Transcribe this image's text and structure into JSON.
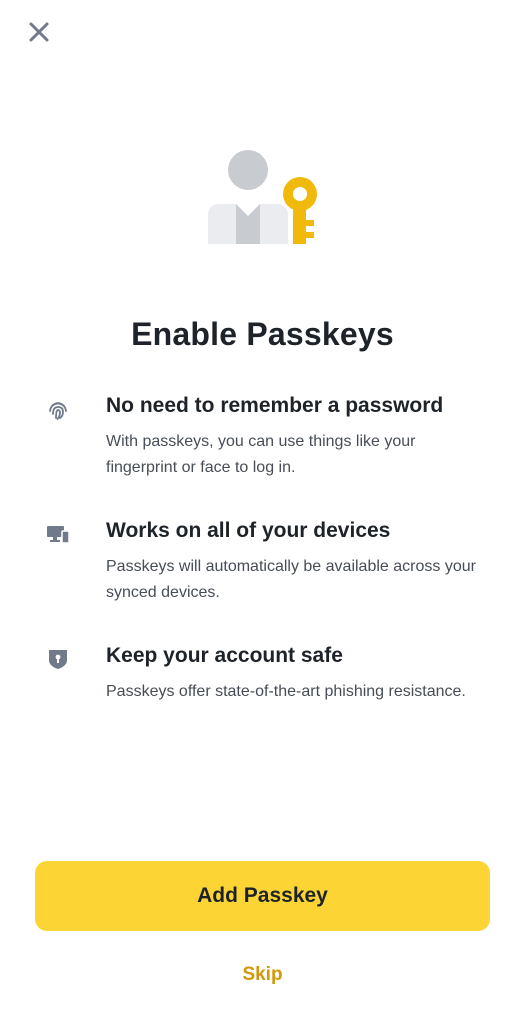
{
  "header": {
    "close_icon": "close-icon"
  },
  "hero": {
    "icon": "person-with-key-illustration",
    "colors": {
      "person": "#c8cbd0",
      "body": "#eaecef",
      "key": "#f0b90b"
    }
  },
  "title": "Enable Passkeys",
  "features": [
    {
      "icon": "fingerprint-icon",
      "heading": "No need to remember a password",
      "description": "With passkeys, you can use things like your fingerprint or face to log in."
    },
    {
      "icon": "devices-icon",
      "heading": "Works on all of your devices",
      "description": "Passkeys will automatically be available across your synced devices."
    },
    {
      "icon": "shield-icon",
      "heading": "Keep your account safe",
      "description": "Passkeys offer state-of-the-art phishing resistance."
    }
  ],
  "actions": {
    "primary_label": "Add Passkey",
    "secondary_label": "Skip"
  },
  "colors": {
    "accent": "#fcd535",
    "link": "#d0980b",
    "text_primary": "#1e2329",
    "text_secondary": "#474d57",
    "icon_gray": "#707a8a"
  }
}
